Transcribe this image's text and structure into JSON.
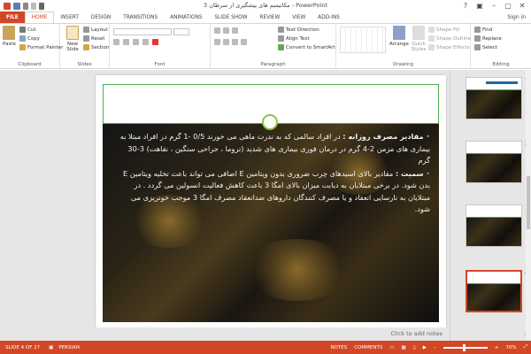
{
  "window": {
    "title": "مکانیسم های پیشگیری از سرطان 3 - PowerPoint",
    "sign_in": "Sign in"
  },
  "tabs": [
    "FILE",
    "HOME",
    "INSERT",
    "DESIGN",
    "TRANSITIONS",
    "ANIMATIONS",
    "SLIDE SHOW",
    "REVIEW",
    "VIEW",
    "ADD-INS"
  ],
  "ribbon": {
    "clipboard": {
      "paste": "Paste",
      "cut": "Cut",
      "copy": "Copy",
      "format_painter": "Format Painter",
      "label": "Clipboard"
    },
    "slides": {
      "new_slide": "New Slide",
      "layout": "Layout",
      "reset": "Reset",
      "section": "Section",
      "label": "Slides"
    },
    "font": {
      "label": "Font"
    },
    "paragraph": {
      "text_direction": "Text Direction",
      "align_text": "Align Text",
      "convert_smartart": "Convert to SmartArt",
      "label": "Paragraph"
    },
    "drawing": {
      "arrange": "Arrange",
      "quick_styles": "Quick Styles",
      "shape_fill": "Shape Fill",
      "shape_outline": "Shape Outline",
      "shape_effects": "Shape Effects",
      "label": "Drawing"
    },
    "editing": {
      "find": "Find",
      "replace": "Replace",
      "select": "Select",
      "label": "Editing"
    }
  },
  "slide": {
    "p1_head": "مقادیر مصرف روزانه :",
    "p1_text": "در افراد سالمی که به ندرت ماهی می خورند 0/5 -1 گرم در افراد مبتلا به بیماری های مزمن 2-4 گرم در درمان فوری بیماری های شدید (تروما ، جراحی سنگین ، نقاهت) 3-30 گرم",
    "p2_head": "سمیت :",
    "p2_text": "مقادیر بالای اسیدهای چرب ضروری بدون ویتامین E اضافی می تواند باعث تخلیه ویتامین E بدن شود. در برخی مبتلایان به دیابت میزان بالای امگا 3 باعث کاهش فعالیت انسولین می گردد . در مبتلایان به نارسایی انعقاد و یا مصرف کنندگان داروهای ضدانعقاد مصرف امگا 3 موجب خونریزی می شود."
  },
  "notes_placeholder": "Click to add notes",
  "thumbnails": [
    "1",
    "2",
    "3",
    "4",
    "5"
  ],
  "status": {
    "slide_info": "SLIDE 4 OF 27",
    "language": "PERSIAN",
    "notes": "NOTES",
    "comments": "COMMENTS",
    "zoom": "70%"
  },
  "colors": {
    "accent": "#d24726",
    "frame_green": "#4caf50",
    "bullet_blue": "#4aa3df"
  }
}
